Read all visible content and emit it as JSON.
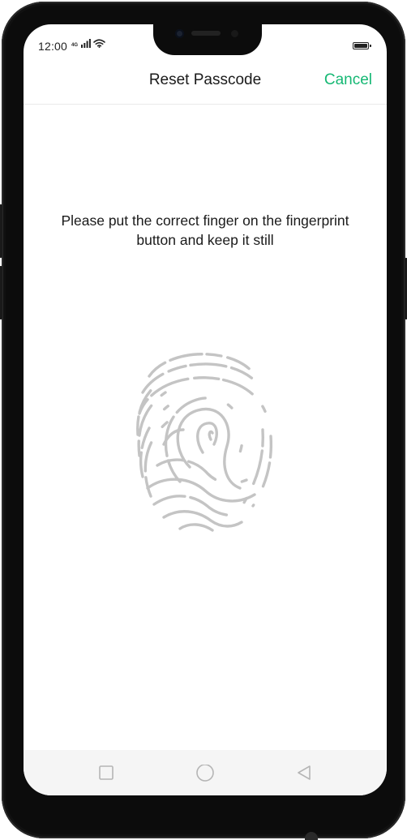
{
  "status_bar": {
    "time": "12:00",
    "network_label": "4G",
    "signal_icon": "signal-bars-icon",
    "wifi_icon": "wifi-icon",
    "battery_icon": "battery-icon",
    "battery_level": 1.0
  },
  "header": {
    "title": "Reset Passcode",
    "cancel_label": "Cancel"
  },
  "main": {
    "instruction": "Please put the correct finger on the fingerprint button and keep it still",
    "fingerprint_icon": "fingerprint-icon"
  },
  "nav_bar": {
    "recents_icon": "square-icon",
    "home_icon": "circle-icon",
    "back_icon": "triangle-back-icon"
  },
  "colors": {
    "accent": "#16b874",
    "text": "#1a1a1a",
    "fingerprint": "#c4c4c4",
    "nav_icons": "#b5b5b5",
    "nav_background": "#f5f5f5",
    "frame": "#0c0c0c"
  }
}
